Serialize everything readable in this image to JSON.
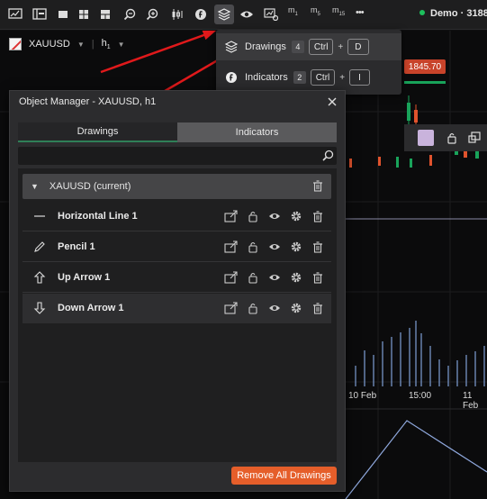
{
  "toolbar": {
    "timeframes": [
      {
        "letter": "m",
        "sub": "1"
      },
      {
        "letter": "m",
        "sub": "5"
      },
      {
        "letter": "m",
        "sub": "15"
      }
    ],
    "more": "•••",
    "account": "Demo · 3188"
  },
  "chart": {
    "symbol": "XAUUSD",
    "timeframe_letter": "h",
    "timeframe_sub": "1",
    "price": "1845.70",
    "time_labels": [
      "10 Feb",
      "15:00",
      "11 Feb"
    ]
  },
  "menu": {
    "items": [
      {
        "label": "Drawings",
        "count": "4",
        "key1": "Ctrl",
        "plus": "+",
        "key2": "D"
      },
      {
        "label": "Indicators",
        "count": "2",
        "key1": "Ctrl",
        "plus": "+",
        "key2": "I"
      }
    ]
  },
  "dialog": {
    "title": "Object Manager - XAUUSD, h1",
    "tabs": [
      "Drawings",
      "Indicators"
    ],
    "search_value": "",
    "group_label": "XAUUSD (current)",
    "items": [
      {
        "name": "Horizontal Line 1",
        "icon": "horizontal-line-icon"
      },
      {
        "name": "Pencil 1",
        "icon": "pencil-icon"
      },
      {
        "name": "Up Arrow 1",
        "icon": "up-arrow-icon"
      },
      {
        "name": "Down Arrow 1",
        "icon": "down-arrow-icon"
      }
    ],
    "remove_all": "Remove All Drawings"
  },
  "colors": {
    "accent": "#e55e2a",
    "price_tag": "#c8432a",
    "active_tab_line": "#2f7f57",
    "annotation_arrow": "#e0191b"
  }
}
